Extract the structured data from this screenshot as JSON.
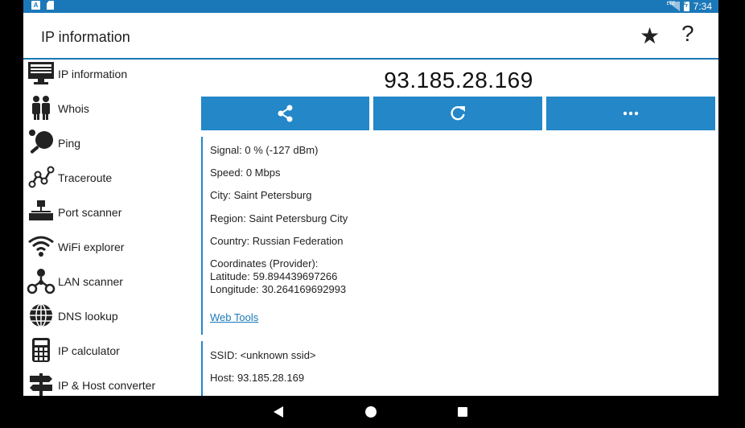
{
  "status_bar": {
    "time": "7:34",
    "signal_label": "LTE"
  },
  "app_bar": {
    "title": "IP information",
    "star_icon": "star-icon",
    "help_icon": "help-icon",
    "help_glyph": "?"
  },
  "sidebar": {
    "items": [
      {
        "label": "IP information",
        "icon": "monitor-icon"
      },
      {
        "label": "Whois",
        "icon": "people-icon"
      },
      {
        "label": "Ping",
        "icon": "ping-pong-icon"
      },
      {
        "label": "Traceroute",
        "icon": "traceroute-icon"
      },
      {
        "label": "Port scanner",
        "icon": "network-tree-icon"
      },
      {
        "label": "WiFi explorer",
        "icon": "wifi-icon"
      },
      {
        "label": "LAN scanner",
        "icon": "lan-icon"
      },
      {
        "label": "DNS lookup",
        "icon": "globe-icon"
      },
      {
        "label": "IP calculator",
        "icon": "calculator-icon"
      },
      {
        "label": "IP & Host converter",
        "icon": "signpost-icon"
      }
    ]
  },
  "main": {
    "ip_address": "93.185.28.169",
    "buttons": [
      {
        "icon": "share-icon"
      },
      {
        "icon": "refresh-icon"
      },
      {
        "icon": "more-icon"
      }
    ],
    "info": {
      "signal": "Signal: 0 % (-127 dBm)",
      "speed": "Speed: 0 Mbps",
      "city": "City: Saint Petersburg",
      "region": "Region: Saint Petersburg City",
      "country": "Country: Russian Federation",
      "coordinates_title": "Coordinates (Provider):",
      "latitude": "Latitude: 59.894439697266",
      "longitude": "Longitude: 30.264169692993",
      "web_tools": "Web Tools"
    },
    "network": {
      "ssid": "SSID: <unknown ssid>",
      "host": "Host: 93.185.28.169"
    }
  },
  "colors": {
    "accent": "#1b78b8",
    "button": "#2387c8",
    "text": "#222222"
  }
}
